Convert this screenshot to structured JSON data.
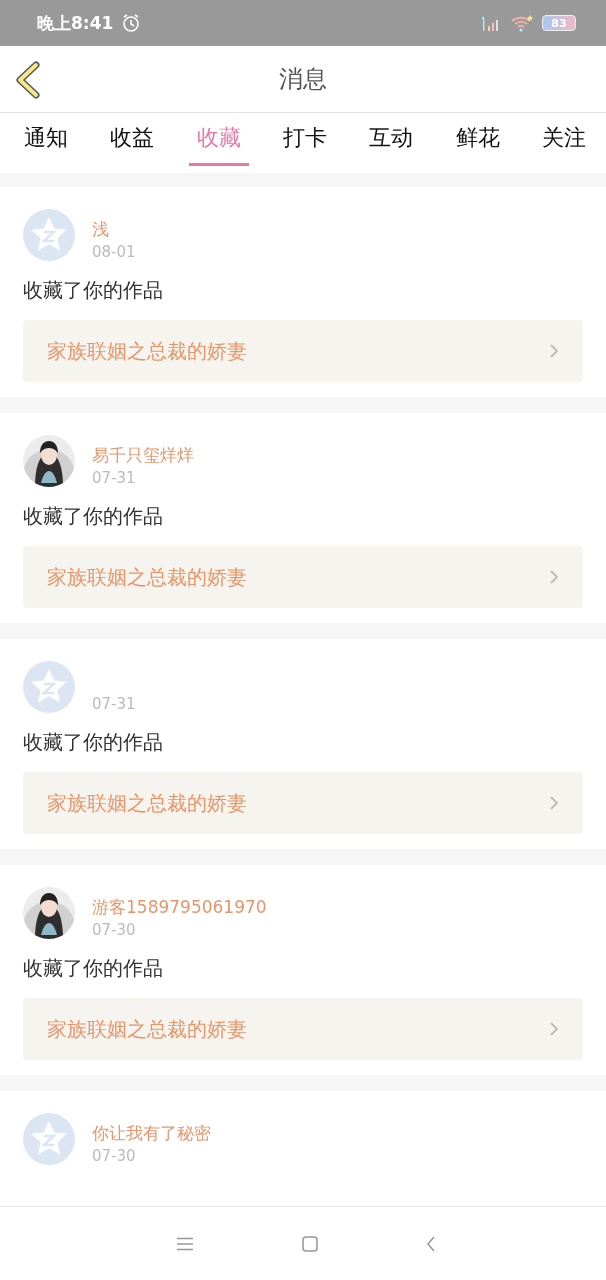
{
  "status_bar": {
    "time": "晚上8:41",
    "battery": "83"
  },
  "header": {
    "title": "消息"
  },
  "tabs": [
    {
      "label": "通知",
      "selected": false
    },
    {
      "label": "收益",
      "selected": false
    },
    {
      "label": "收藏",
      "selected": true
    },
    {
      "label": "打卡",
      "selected": false
    },
    {
      "label": "互动",
      "selected": false
    },
    {
      "label": "鲜花",
      "selected": false
    },
    {
      "label": "关注",
      "selected": false
    }
  ],
  "messages": [
    {
      "avatar": {
        "kind": "default"
      },
      "name": "浅",
      "date": "08-01",
      "action": "收藏了你的作品",
      "work": "家族联姻之总裁的娇妻"
    },
    {
      "name": "易千只玺烊烊",
      "date": "07-31",
      "action": "收藏了你的作品",
      "work": "家族联姻之总裁的娇妻"
    },
    {
      "avatar": {
        "kind": "default"
      },
      "date": "07-31",
      "action": "收藏了你的作品",
      "work": "家族联姻之总裁的娇妻"
    },
    {
      "name": "游客1589795061970",
      "date": "07-30",
      "action": "收藏了你的作品",
      "work": "家族联姻之总裁的娇妻"
    },
    {
      "avatar": {
        "kind": "default"
      },
      "name": "你让我有了秘密",
      "date": "07-30"
    }
  ]
}
